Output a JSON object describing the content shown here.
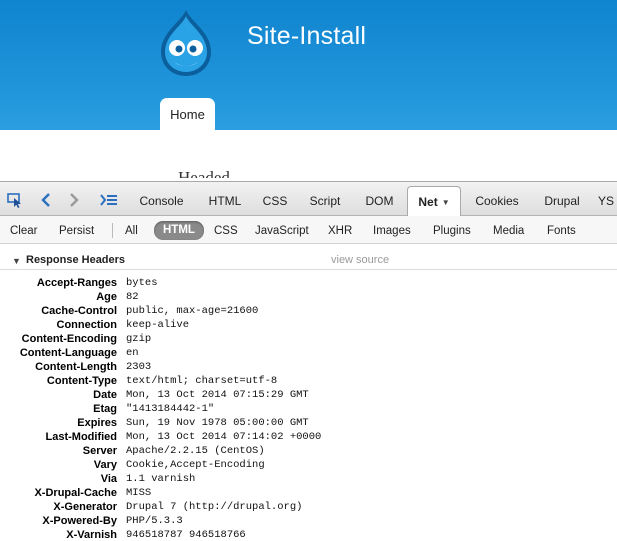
{
  "site": {
    "name": "Site-Install",
    "nav": {
      "home": "Home"
    },
    "heading_peek": "Headed"
  },
  "firebug": {
    "panel_tabs": [
      {
        "label": "Console"
      },
      {
        "label": "HTML"
      },
      {
        "label": "CSS"
      },
      {
        "label": "Script"
      },
      {
        "label": "DOM"
      },
      {
        "label": "Net",
        "active": true
      },
      {
        "label": "Cookies"
      },
      {
        "label": "Drupal"
      },
      {
        "label": "YS"
      }
    ],
    "subbar": {
      "clear": "Clear",
      "persist": "Persist",
      "filters": [
        "All",
        "HTML",
        "CSS",
        "JavaScript",
        "XHR",
        "Images",
        "Plugins",
        "Media",
        "Fonts"
      ],
      "selected_filter": "HTML"
    },
    "response_headers": {
      "title": "Response Headers",
      "view_source": "view source",
      "rows": [
        {
          "name": "Accept-Ranges",
          "value": "bytes"
        },
        {
          "name": "Age",
          "value": "82"
        },
        {
          "name": "Cache-Control",
          "value": "public, max-age=21600"
        },
        {
          "name": "Connection",
          "value": "keep-alive"
        },
        {
          "name": "Content-Encoding",
          "value": "gzip"
        },
        {
          "name": "Content-Language",
          "value": "en"
        },
        {
          "name": "Content-Length",
          "value": "2303"
        },
        {
          "name": "Content-Type",
          "value": "text/html; charset=utf-8"
        },
        {
          "name": "Date",
          "value": "Mon, 13 Oct 2014 07:15:29 GMT"
        },
        {
          "name": "Etag",
          "value": "\"1413184442-1\""
        },
        {
          "name": "Expires",
          "value": "Sun, 19 Nov 1978 05:00:00 GMT"
        },
        {
          "name": "Last-Modified",
          "value": "Mon, 13 Oct 2014 07:14:02 +0000"
        },
        {
          "name": "Server",
          "value": "Apache/2.2.15 (CentOS)"
        },
        {
          "name": "Vary",
          "value": "Cookie,Accept-Encoding"
        },
        {
          "name": "Via",
          "value": "1.1 varnish"
        },
        {
          "name": "X-Drupal-Cache",
          "value": "MISS"
        },
        {
          "name": "X-Generator",
          "value": "Drupal 7 (http://drupal.org)"
        },
        {
          "name": "X-Powered-By",
          "value": "PHP/5.3.3"
        },
        {
          "name": "X-Varnish",
          "value": "946518787 946518766"
        }
      ]
    }
  },
  "colors": {
    "header_blue": "#1f93d9",
    "toolbar_gray": "#dedede",
    "pill_gray": "#8a8a8a"
  },
  "icons": {
    "logo": "drupal-drop-logo",
    "inspect": "inspect-element-icon",
    "back": "back-arrow-icon",
    "forward": "forward-arrow-icon",
    "command_line": "command-line-icon",
    "twisty": "expanded-triangle-icon"
  }
}
